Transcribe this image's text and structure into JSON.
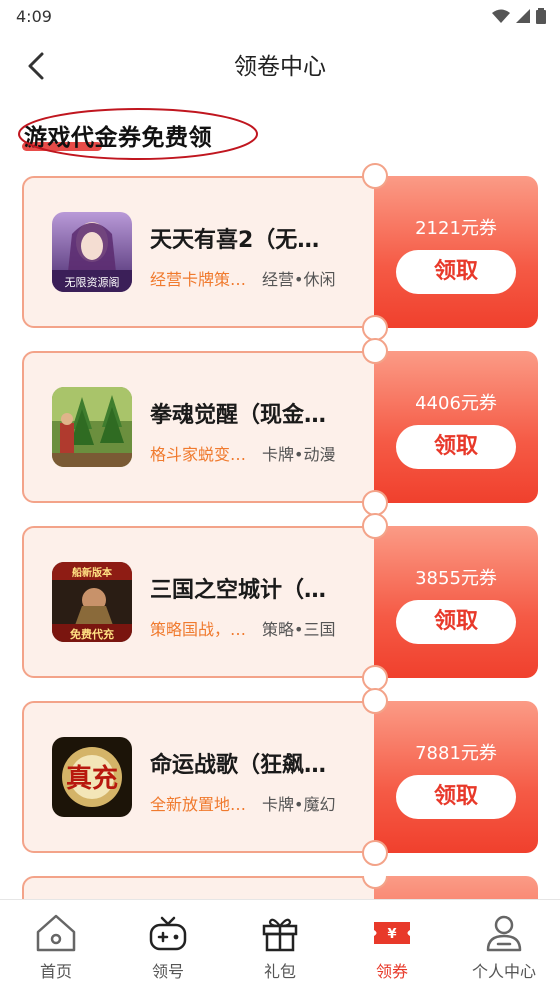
{
  "status": {
    "time": "4:09"
  },
  "header": {
    "title": "领卷中心"
  },
  "section": {
    "title": "游戏代金券免费领"
  },
  "cards": [
    {
      "name": "天天有喜2（无…",
      "desc": "经营卡牌策…",
      "tags": "经营•休闲",
      "amount": "2121元券",
      "button": "领取",
      "icon_text": "无限资源阁"
    },
    {
      "name": "拳魂觉醒（现金…",
      "desc": "格斗家蜕变…",
      "tags": "卡牌•动漫",
      "amount": "4406元券",
      "button": "领取",
      "icon_text": ""
    },
    {
      "name": "三国之空城计（…",
      "desc": "策略国战，…",
      "tags": "策略•三国",
      "amount": "3855元券",
      "button": "领取",
      "icon_text": "船新版本 免费代充"
    },
    {
      "name": "命运战歌（狂飙…",
      "desc": "全新放置地…",
      "tags": "卡牌•魔幻",
      "amount": "7881元券",
      "button": "领取",
      "icon_text": "真充"
    }
  ],
  "tabs": [
    {
      "label": "首页",
      "icon": "home-icon"
    },
    {
      "label": "领号",
      "icon": "gamepad-icon"
    },
    {
      "label": "礼包",
      "icon": "gift-icon"
    },
    {
      "label": "领券",
      "icon": "coupon-icon",
      "active": true
    },
    {
      "label": "个人中心",
      "icon": "user-icon"
    }
  ],
  "colors": {
    "accent": "#e8392a",
    "card_bg": "#fdf0ea",
    "card_border": "#f3a389",
    "desc": "#f07a2e"
  }
}
